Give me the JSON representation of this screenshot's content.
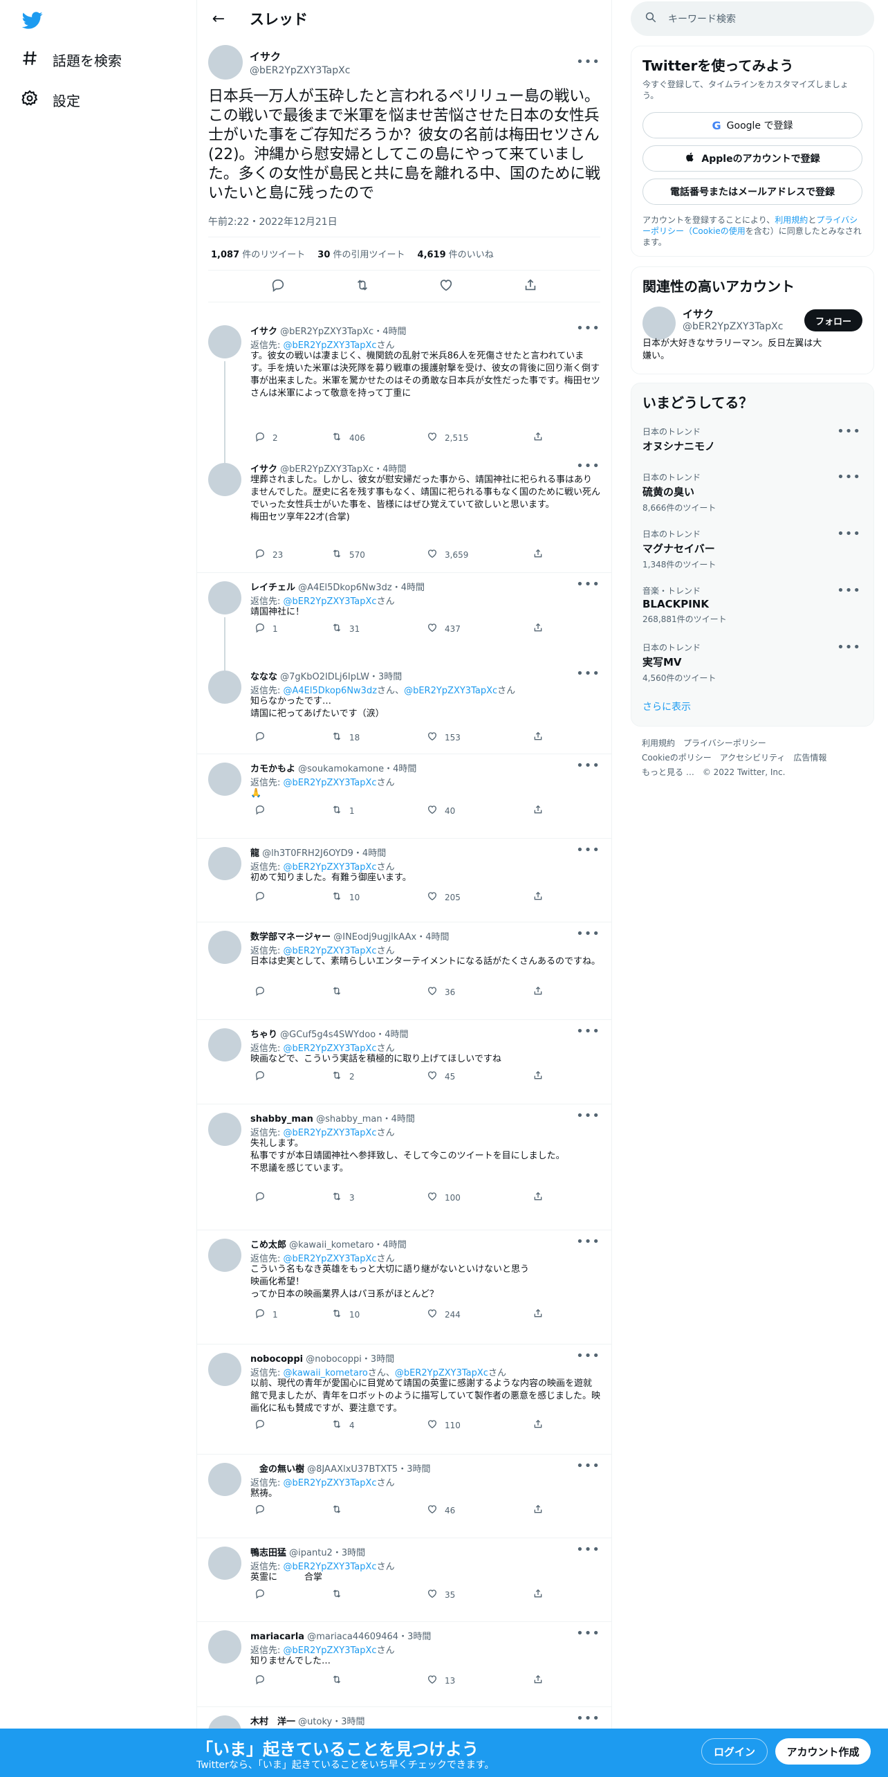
{
  "nav": {
    "explore": "話題を検索",
    "settings": "設定"
  },
  "header": {
    "title": "スレッド"
  },
  "main_tweet": {
    "name": "イサク",
    "handle": "@bER2YpZXY3TapXc",
    "text": "日本兵一万人が玉砕したと言われるペリリュー島の戦い。この戦いで最後まで米軍を悩ませ苦悩させた日本の女性兵士がいた事をご存知だろうか？彼女の名前は梅田セツさん(22)。沖縄から慰安婦としてこの島にやって来ていました。多くの女性が島民と共に島を離れる中、国のために戦いたいと島に残ったので",
    "time": "午前2:22・2022年12月21日",
    "retweets": "1,087",
    "retweets_label": "件のリツイート",
    "quotes": "30",
    "quotes_label": "件の引用ツイート",
    "likes": "4,619",
    "likes_label": "件のいいね"
  },
  "reply_prefix": "返信先: ",
  "reply_suffix": "さん",
  "replies": [
    {
      "name": "イサク",
      "handle": "@bER2YpZXY3TapXc",
      "time": "4時間",
      "to": [
        "@bER2YpZXY3TapXc"
      ],
      "text": "す。彼女の戦いは凄まじく、機関銃の乱射で米兵86人を死傷させたと言われています。手を焼いた米軍は決死隊を募り戦車の援護射撃を受け、彼女の背後に回り漸く倒す事が出来ました。米軍を驚かせたのはその勇敢な日本兵が女性だった事です。梅田セツさんは米軍によって敬意を持って丁重に",
      "replies": "2",
      "retweets": "406",
      "likes": "2,515"
    },
    {
      "name": "イサク",
      "handle": "@bER2YpZXY3TapXc",
      "time": "4時間",
      "to": [],
      "text": "埋葬されました。しかし、彼女が慰安婦だった事から、靖国神社に祀られる事はありませんでした。歴史に名を残す事もなく、靖国に祀られる事もなく国のために戦い死んでいった女性兵士がいた事を、皆様にはぜひ覚えていて欲しいと思います。\n梅田セツ享年22才(合掌)",
      "replies": "23",
      "retweets": "570",
      "likes": "3,659"
    },
    {
      "name": "レイチェル",
      "handle": "@A4El5Dkop6Nw3dz",
      "time": "4時間",
      "to": [
        "@bER2YpZXY3TapXc"
      ],
      "text": "靖国神社に！",
      "replies": "1",
      "retweets": "31",
      "likes": "437"
    },
    {
      "name": "ななな",
      "handle": "@7gKbO2IDLj6IpLW",
      "time": "3時間",
      "to": [
        "@A4El5Dkop6Nw3dz",
        "@bER2YpZXY3TapXc"
      ],
      "text": "知らなかったです…\n靖国に祀ってあげたいです（涙）",
      "replies": "",
      "retweets": "18",
      "likes": "153"
    },
    {
      "name": "カモかもよ",
      "handle": "@soukamokamone",
      "time": "4時間",
      "to": [
        "@bER2YpZXY3TapXc"
      ],
      "text": "🙏",
      "replies": "",
      "retweets": "1",
      "likes": "40"
    },
    {
      "name": "龍",
      "handle": "@lh3T0FRH2J6OYD9",
      "time": "4時間",
      "to": [
        "@bER2YpZXY3TapXc"
      ],
      "text": "初めて知りました。有難う御座います。",
      "replies": "",
      "retweets": "10",
      "likes": "205"
    },
    {
      "name": "数学部マネージャー",
      "handle": "@INEodj9ugjlkAAx",
      "time": "4時間",
      "to": [
        "@bER2YpZXY3TapXc"
      ],
      "text": "日本は史実として、素晴らしいエンターテイメントになる話がたくさんあるのですね。",
      "replies": "",
      "retweets": "",
      "likes": "36"
    },
    {
      "name": "ちゃり",
      "handle": "@GCuf5g4s4SWYdoo",
      "time": "4時間",
      "to": [
        "@bER2YpZXY3TapXc"
      ],
      "text": "映画などで、こういう実話を積極的に取り上げてほしいですね",
      "replies": "",
      "retweets": "2",
      "likes": "45"
    },
    {
      "name": "shabby_man",
      "handle": "@shabby_man",
      "time": "4時間",
      "to": [
        "@bER2YpZXY3TapXc"
      ],
      "text": "失礼します。\n私事ですが本日靖國神社へ参拝致し、そして今このツイートを目にしました。\n不思議を感じています。",
      "replies": "",
      "retweets": "3",
      "likes": "100"
    },
    {
      "name": "こめ太郎",
      "handle": "@kawaii_kometaro",
      "time": "4時間",
      "to": [
        "@bER2YpZXY3TapXc"
      ],
      "text": "こういう名もなき英雄をもっと大切に語り継がないといけないと思う\n映画化希望！\nってか日本の映画業界人はパヨ系がほとんど？",
      "replies": "1",
      "retweets": "10",
      "likes": "244"
    },
    {
      "name": "nobocoppi",
      "handle": "@nobocoppi",
      "time": "3時間",
      "to": [
        "@kawaii_kometaro",
        "@bER2YpZXY3TapXc"
      ],
      "text": "以前、現代の青年が愛国心に目覚めて靖国の英霊に感謝するような内容の映画を遊就館で見ましたが、青年をロボットのように描写していて製作者の悪意を感じました。映画化に私も賛成ですが、要注意です。",
      "replies": "",
      "retweets": "4",
      "likes": "110"
    },
    {
      "name": "　金の無い樹",
      "handle": "@8JAAXlxU37BTXT5",
      "time": "3時間",
      "to": [
        "@bER2YpZXY3TapXc"
      ],
      "text": "黙祷。",
      "replies": "",
      "retweets": "",
      "likes": "46"
    },
    {
      "name": "鴨志田猛",
      "handle": "@ipantu2",
      "time": "3時間",
      "to": [
        "@bER2YpZXY3TapXc"
      ],
      "text": "英霊に　　　合掌",
      "replies": "",
      "retweets": "",
      "likes": "35"
    },
    {
      "name": "mariacarla",
      "handle": "@mariaca44609464",
      "time": "3時間",
      "to": [
        "@bER2YpZXY3TapXc"
      ],
      "text": "知りませんでした…",
      "replies": "",
      "retweets": "",
      "likes": "13"
    },
    {
      "name": "木村　洋一",
      "handle": "@utoky",
      "time": "3時間",
      "to": [],
      "text": "",
      "replies": "",
      "retweets": "",
      "likes": ""
    }
  ],
  "search": {
    "placeholder": "キーワード検索"
  },
  "signup": {
    "title": "Twitterを使ってみよう",
    "desc": "今すぐ登録して、タイムラインをカスタマイズしましょう。",
    "google": "Google で登録",
    "apple": "Appleのアカウントで登録",
    "phone": "電話番号またはメールアドレスで登録",
    "terms_pre": "アカウントを登録することにより、",
    "terms_link1": "利用規約",
    "terms_and": "と",
    "terms_link2": "プライバシーポリシー（Cookieの使用",
    "terms_post": "を含む）に同意したとみなされます。"
  },
  "related": {
    "title": "関連性の高いアカウント",
    "name": "イサク",
    "handle": "@bER2YpZXY3TapXc",
    "bio": "日本が大好きなサラリーマン。反日左翼は大嫌い。",
    "follow": "フォロー"
  },
  "trends": {
    "title": "いまどうしてる？",
    "items": [
      {
        "context": "日本のトレンド",
        "name": "オヌシナニモノ",
        "count": ""
      },
      {
        "context": "日本のトレンド",
        "name": "硫黄の臭い",
        "count": "8,666件のツイート"
      },
      {
        "context": "日本のトレンド",
        "name": "マグナセイバー",
        "count": "1,348件のツイート"
      },
      {
        "context": "音楽・トレンド",
        "name": "BLACKPINK",
        "count": "268,881件のツイート"
      },
      {
        "context": "日本のトレンド",
        "name": "実写MV",
        "count": "4,560件のツイート"
      }
    ],
    "show_more": "さらに表示"
  },
  "footer": {
    "terms": "利用規約",
    "privacy": "プライバシーポリシー",
    "cookie": "Cookieのポリシー",
    "access": "アクセシビリティ",
    "ads": "広告情報",
    "more": "もっと見る …",
    "copyright": "© 2022 Twitter, Inc."
  },
  "bottombar": {
    "title": "「いま」起きていることを見つけよう",
    "sub": "Twitterなら、「いま」起きていることをいち早くチェックできます。",
    "login": "ログイン",
    "signup": "アカウント作成"
  },
  "colors": {
    "accent": "#1d9bf0",
    "text": "#0f1419",
    "muted": "#536471"
  }
}
